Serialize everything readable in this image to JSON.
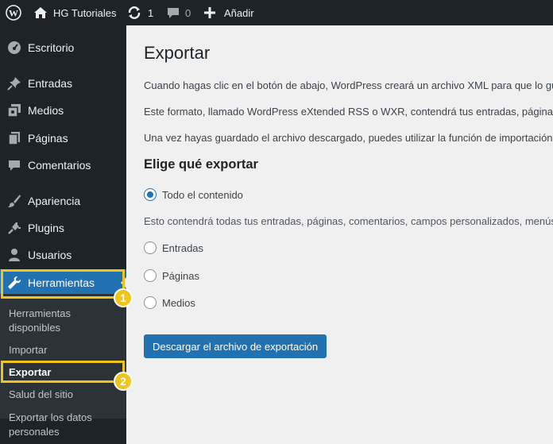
{
  "adminbar": {
    "site_name": "HG Tutoriales",
    "updates_count": "1",
    "comments_count": "0",
    "new_label": "Añadir",
    "icons": [
      "wordpress-icon",
      "home-icon",
      "update-icon",
      "comment-icon",
      "plus-icon"
    ]
  },
  "sidebar": {
    "items": [
      {
        "label": "Escritorio",
        "icon": "dashboard-icon"
      },
      {
        "label": "Entradas",
        "icon": "pushpin-icon"
      },
      {
        "label": "Medios",
        "icon": "media-icon"
      },
      {
        "label": "Páginas",
        "icon": "pages-icon"
      },
      {
        "label": "Comentarios",
        "icon": "comment-icon"
      },
      {
        "label": "Apariencia",
        "icon": "brush-icon"
      },
      {
        "label": "Plugins",
        "icon": "plugin-icon"
      },
      {
        "label": "Usuarios",
        "icon": "user-icon"
      },
      {
        "label": "Herramientas",
        "icon": "wrench-icon"
      }
    ],
    "submenu": [
      {
        "label": "Herramientas disponibles"
      },
      {
        "label": "Importar"
      },
      {
        "label": "Exportar"
      },
      {
        "label": "Salud del sitio"
      },
      {
        "label": "Exportar los datos personales"
      }
    ],
    "badges": [
      "1",
      "2"
    ]
  },
  "main": {
    "title": "Exportar",
    "paragraphs": [
      "Cuando hagas clic en el botón de abajo, WordPress creará un archivo XML para que lo guardes",
      "Este formato, llamado WordPress eXtended RSS o WXR, contendrá tus entradas, páginas, comentarios",
      "Una vez hayas guardado el archivo descargado, puedes utilizar la función de importación de otro"
    ],
    "section_title": "Elige qué exportar",
    "options": [
      {
        "label": "Todo el contenido",
        "checked": true
      },
      {
        "label": "Entradas",
        "checked": false
      },
      {
        "label": "Páginas",
        "checked": false
      },
      {
        "label": "Medios",
        "checked": false
      }
    ],
    "all_content_desc": "Esto contendrá todas tus entradas, páginas, comentarios, campos personalizados, menús de",
    "download_button": "Descargar el archivo de exportación"
  },
  "colors": {
    "adminbar_bg": "#1d2327",
    "accent": "#2271b1",
    "highlight": "#f0c419"
  }
}
